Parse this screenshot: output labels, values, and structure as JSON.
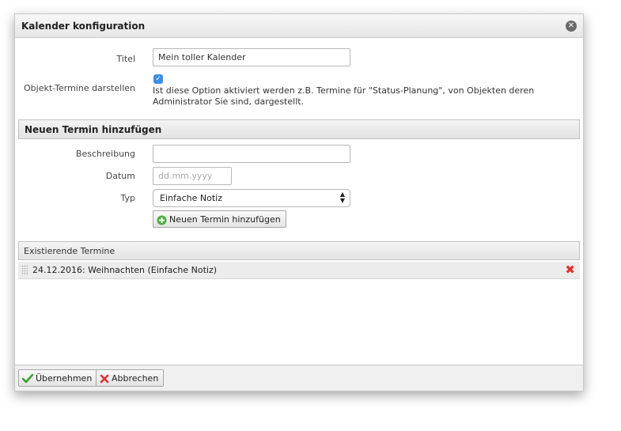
{
  "dialog": {
    "title": "Kalender konfiguration",
    "close_icon": "close-icon"
  },
  "config": {
    "title_label": "Titel",
    "title_value": "Mein toller Kalender",
    "objects_label": "Objekt-Termine darstellen",
    "objects_checked": true,
    "objects_description": "Ist diese Option aktiviert werden z.B. Termine für \"Status-Planung\", von Objekten deren Administrator Sie sind, dargestellt."
  },
  "new_event": {
    "section_title": "Neuen Termin hinzufügen",
    "description_label": "Beschreibung",
    "description_value": "",
    "date_label": "Datum",
    "date_placeholder": "dd.mm.yyyy",
    "type_label": "Typ",
    "type_selected": "Einfache Notiz",
    "add_button_label": "Neuen Termin hinzufügen",
    "add_button_icon": "plus-circle-icon"
  },
  "existing": {
    "header": "Existierende Termine",
    "items": [
      {
        "label": "24.12.2016: Weihnachten (Einfache Notiz)",
        "delete_icon": "delete-icon"
      }
    ]
  },
  "footer": {
    "apply_label": "Übernehmen",
    "apply_icon": "checkmark-icon",
    "cancel_label": "Abbrechen",
    "cancel_icon": "cross-icon"
  },
  "colors": {
    "checkbox": "#3d8ee8",
    "apply_icon": "#3aa02f",
    "cancel_icon": "#e03030",
    "add_icon": "#4cae3f"
  }
}
